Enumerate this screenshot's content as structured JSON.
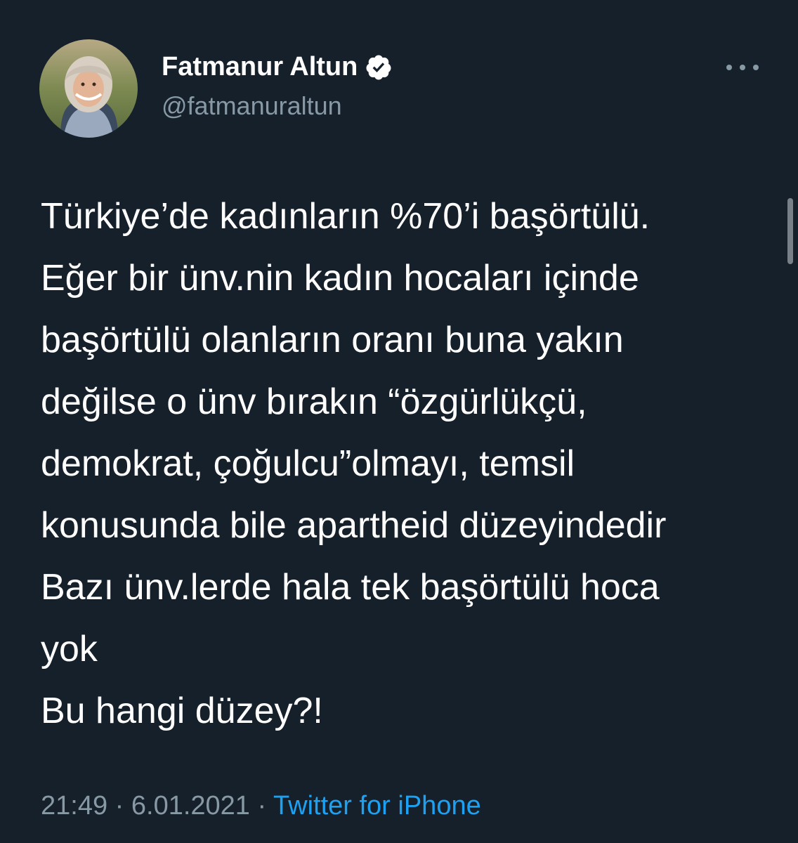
{
  "author": {
    "display_name": "Fatmanur Altun",
    "handle": "@fatmanuraltun",
    "verified": true
  },
  "icons": {
    "verified": "verified-badge-icon",
    "more": "more-options-icon"
  },
  "tweet": {
    "lines": [
      "Türkiye’de kadınların %70’i başörtülü.",
      "Eğer bir ünv.nin kadın hocaları içinde",
      "başörtülü olanların oranı buna yakın",
      "değilse o ünv bırakın “özgürlükçü,",
      "demokrat, çoğulcu”olmayı, temsil",
      "konusunda bile apartheid düzeyindedir",
      "Bazı ünv.lerde hala tek başörtülü hoca",
      "yok",
      "Bu hangi düzey?!"
    ]
  },
  "meta": {
    "time": "21:49",
    "separator": " · ",
    "date": "6.01.2021",
    "source": "Twitter for iPhone"
  },
  "colors": {
    "background": "#15202b",
    "primary_text": "#ffffff",
    "secondary_text": "#8899a6",
    "link": "#1da1f2"
  }
}
